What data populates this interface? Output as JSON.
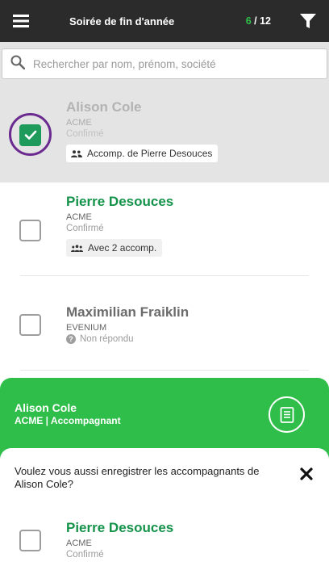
{
  "header": {
    "title": "Soirée de fin d'année",
    "counter_done": "6",
    "counter_total": "/ 12",
    "menu_icon": "hamburger-icon",
    "filter_icon": "filter-icon"
  },
  "search": {
    "placeholder": "Rechercher par nom, prénom, société",
    "value": ""
  },
  "guests": [
    {
      "name": "Alison Cole",
      "company": "ACME",
      "status": "Confirmé",
      "badge": "Accomp. de Pierre Desouces",
      "checked": true
    },
    {
      "name": "Pierre Desouces",
      "company": "ACME",
      "status": "Confirmé",
      "badge": "Avec 2 accomp.",
      "checked": false
    },
    {
      "name": "Maximilian Fraiklin",
      "company": "EVENIUM",
      "status": "Non répondu",
      "checked": false
    }
  ],
  "panel": {
    "name": "Alison Cole",
    "subtitle": "ACME | Accompagnant",
    "notes_icon": "notes-icon"
  },
  "dialog": {
    "question": "Voulez vous aussi enregistrer les accompagnants de Alison Cole?",
    "close_icon": "close-icon",
    "companions": [
      {
        "name": "Pierre Desouces",
        "company": "ACME",
        "status": "Confirmé",
        "checked": false
      }
    ]
  },
  "colors": {
    "topbar": "#2b2b2b",
    "accent_green": "#2fbe4a",
    "name_green": "#15934a",
    "checkbox_checked": "#1e9a5a",
    "highlight_ring": "#6a2a8f"
  }
}
